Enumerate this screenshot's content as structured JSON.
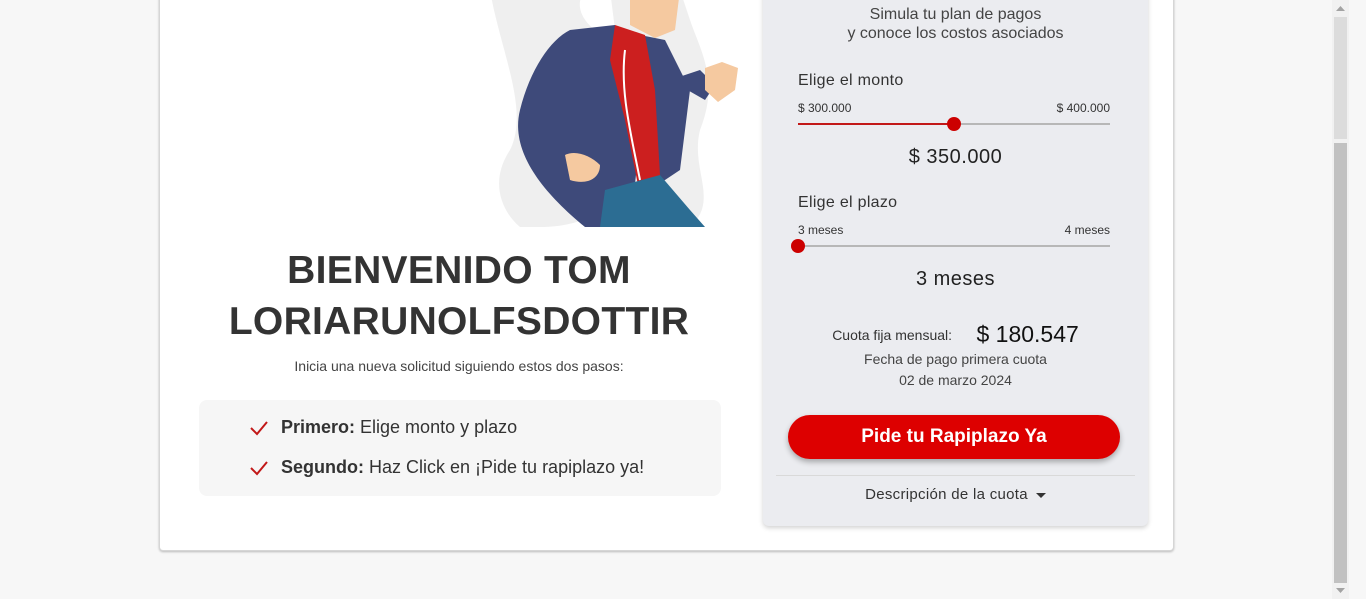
{
  "welcome": {
    "line1": "BIENVENIDO TOM",
    "line2": "LORIARUNOLFSDOTTIR",
    "subtitle": "Inicia una nueva solicitud siguiendo estos dos pasos:",
    "steps": [
      {
        "bold": "Primero:",
        "text": "Elige monto y plazo"
      },
      {
        "bold": "Segundo:",
        "text": "Haz Click en ¡Pide tu rapiplazo ya!"
      }
    ]
  },
  "simulator": {
    "intro_line1": "Simula tu plan de pagos",
    "intro_line2": "y conoce los costos asociados",
    "amount": {
      "label": "Elige el monto",
      "min": "$ 300.000",
      "max": "$ 400.000",
      "value": "$ 350.000",
      "fraction": 0.5
    },
    "term": {
      "label": "Elige el plazo",
      "min": "3 meses",
      "max": "4 meses",
      "value": "3 meses",
      "fraction": 0
    },
    "cuota_label": "Cuota fija mensual:",
    "cuota_value": "$ 180.547",
    "fecha_label": "Fecha de pago primera cuota",
    "fecha_value": "02 de marzo 2024",
    "cta_label": "Pide tu Rapiplazo Ya",
    "desc_label": "Descripción de la cuota"
  },
  "colors": {
    "accent": "#dd0000",
    "slider_fill": "#c21818"
  }
}
